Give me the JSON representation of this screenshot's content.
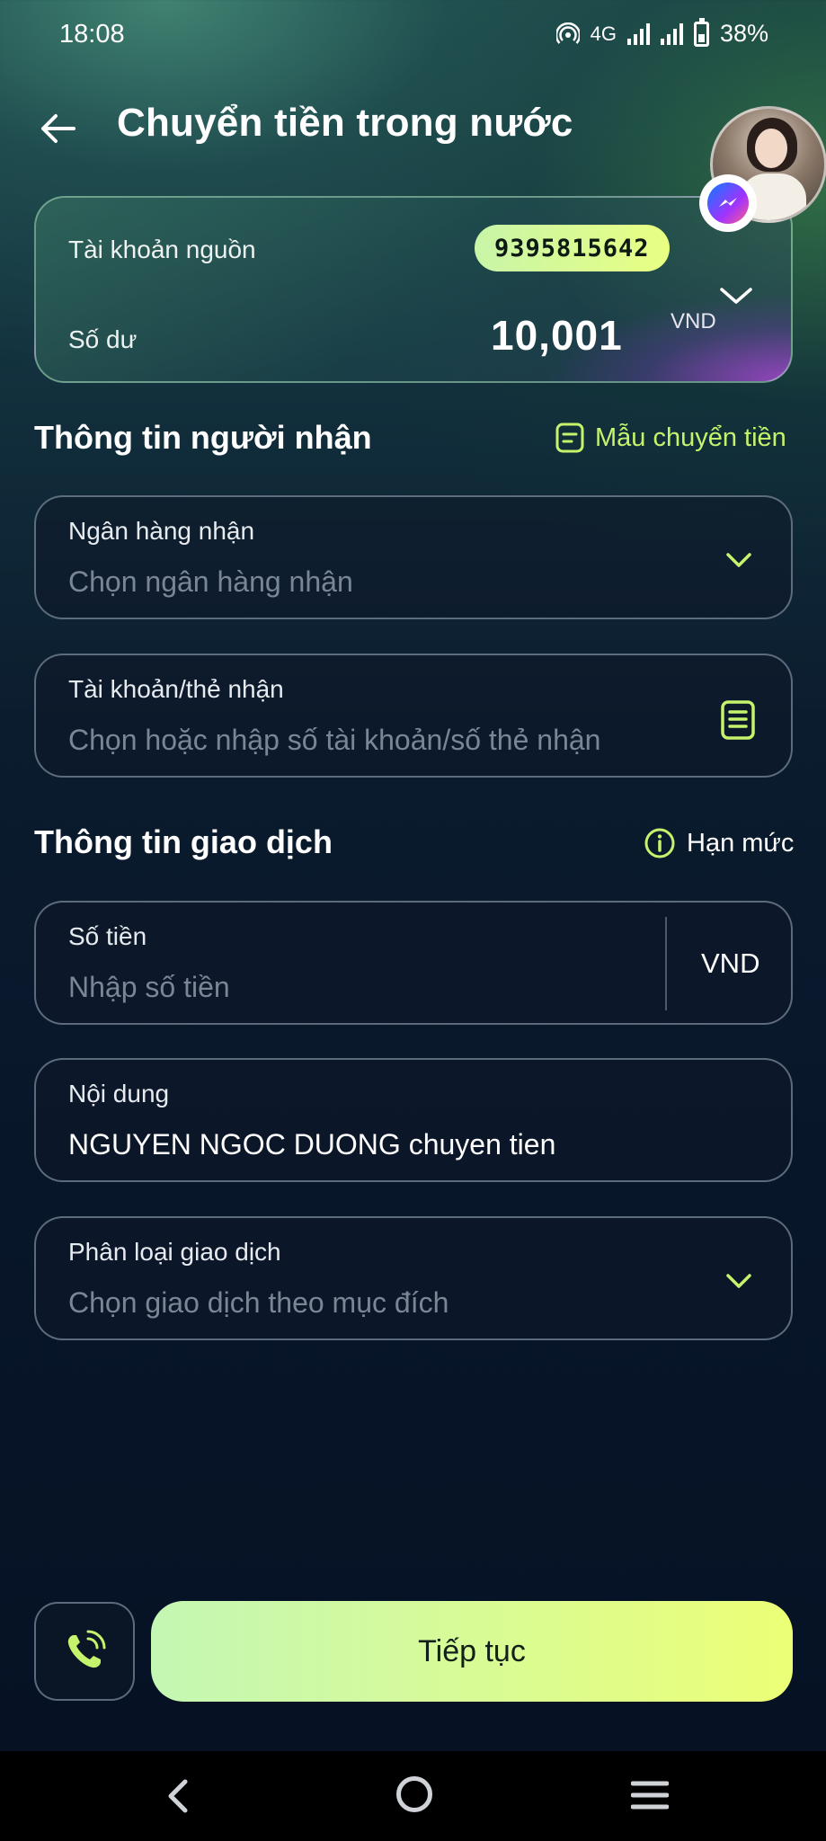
{
  "status_bar": {
    "time": "18:08",
    "network": "4G",
    "battery": "38%"
  },
  "header": {
    "title": "Chuyển tiền trong nước",
    "back_icon": "arrow-left-icon"
  },
  "floating_chat": {
    "icons": [
      "avatar",
      "messenger-icon"
    ]
  },
  "source_account": {
    "label": "Tài khoản nguồn",
    "account_number": "9395815642",
    "balance_label": "Số dư",
    "balance_value": "10,001",
    "currency": "VND"
  },
  "recipient_section": {
    "title": "Thông tin người nhận",
    "template_link": "Mẫu chuyển tiền",
    "bank_field": {
      "label": "Ngân hàng nhận",
      "placeholder": "Chọn ngân hàng nhận"
    },
    "account_field": {
      "label": "Tài khoản/thẻ nhận",
      "placeholder": "Chọn hoặc nhập số tài khoản/số thẻ nhận"
    }
  },
  "transaction_section": {
    "title": "Thông tin giao dịch",
    "limit_link": "Hạn mức",
    "amount_field": {
      "label": "Số tiền",
      "placeholder": "Nhập số tiền",
      "currency": "VND"
    },
    "content_field": {
      "label": "Nội dung",
      "value": "NGUYEN NGOC DUONG chuyen tien"
    },
    "category_field": {
      "label": "Phân loại giao dịch",
      "placeholder": "Chọn giao dịch theo mục đích"
    }
  },
  "footer": {
    "continue_label": "Tiếp tục",
    "call_icon": "phone-call-icon"
  },
  "colors": {
    "accent": "#c6f36c",
    "button_gradient_start": "#c4f7b4",
    "button_gradient_end": "#ecff76",
    "card_purple": "#a848d2",
    "background": "#08162a"
  }
}
